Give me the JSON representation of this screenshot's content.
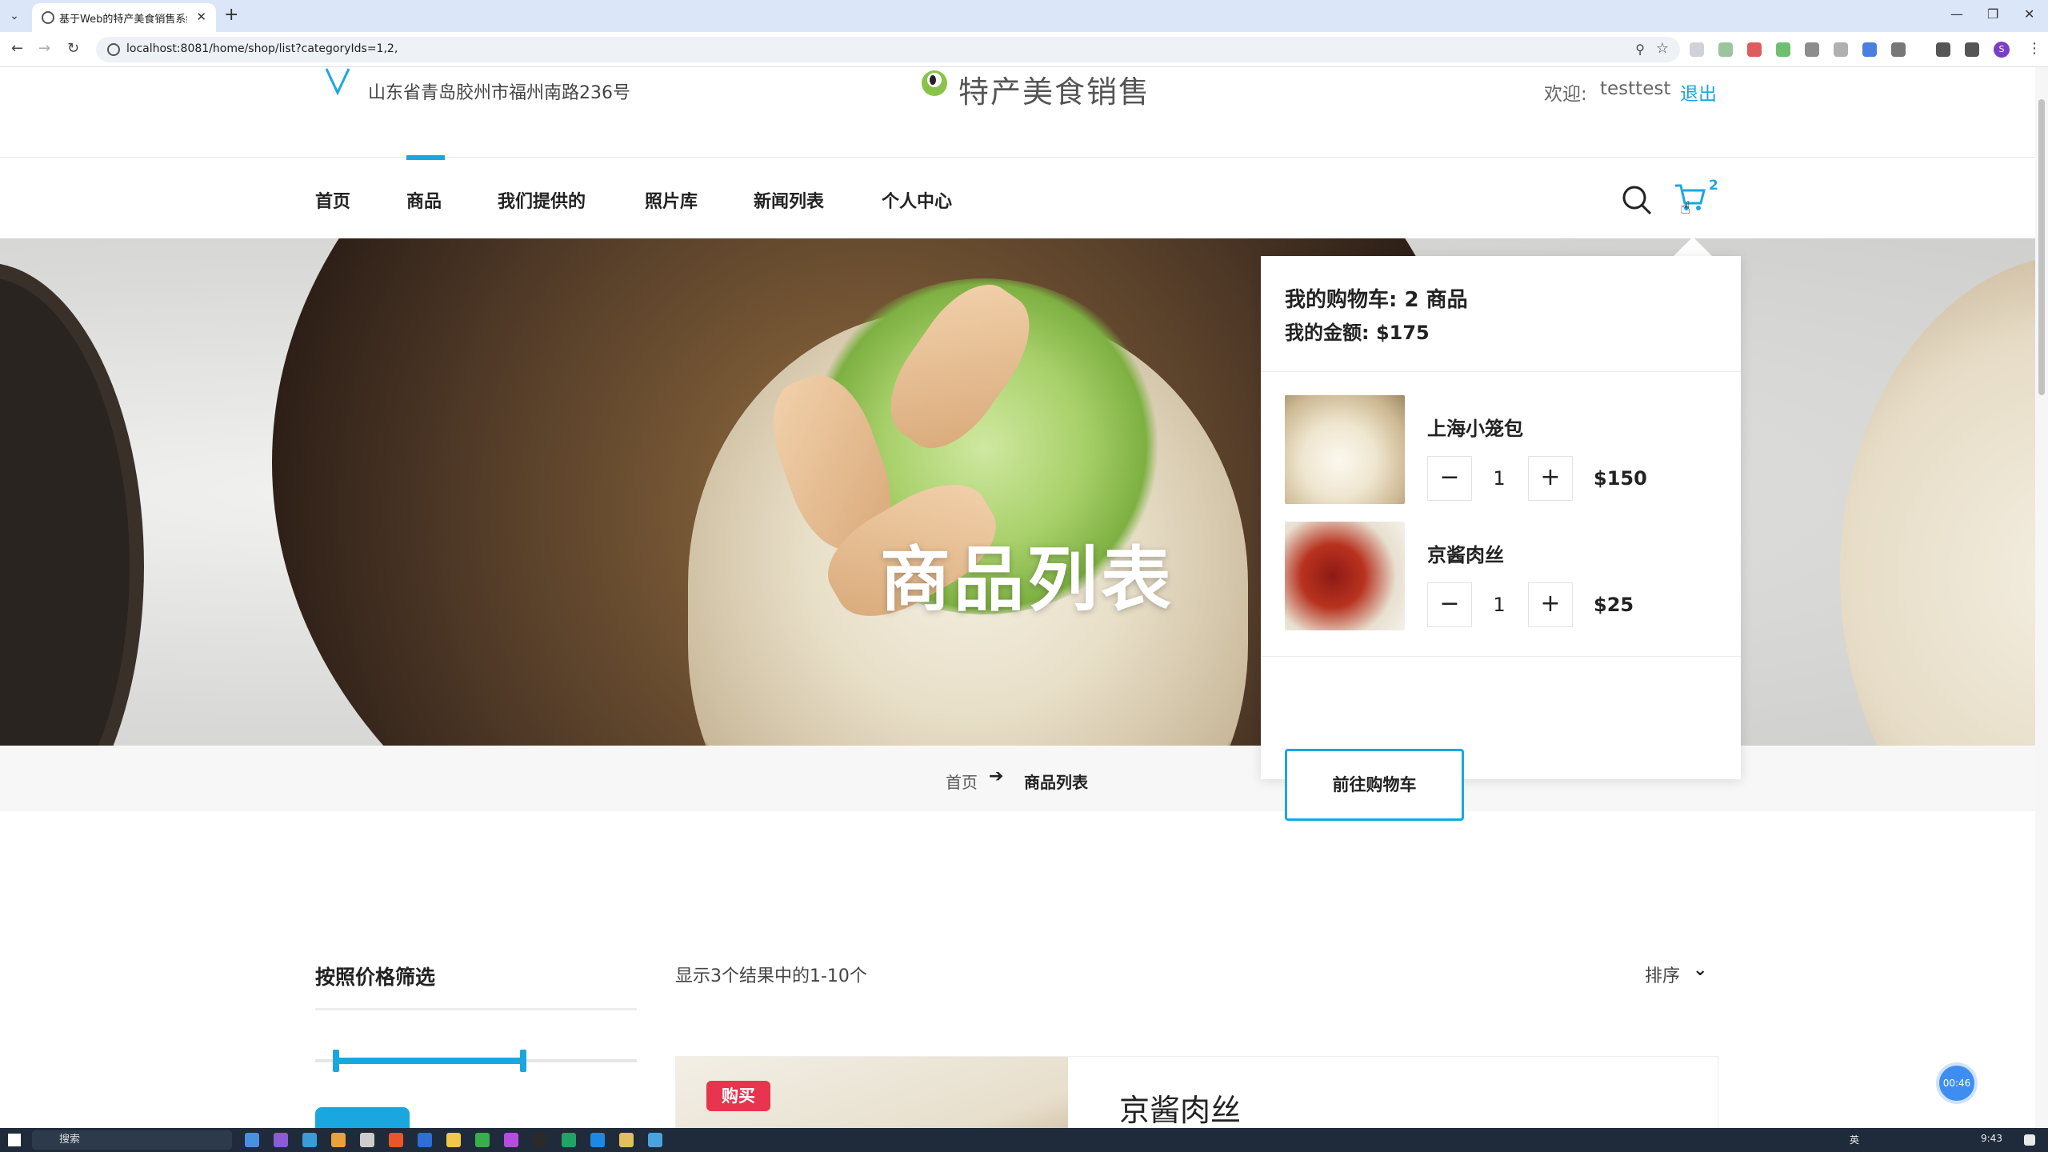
{
  "browser": {
    "tab_title": "基于Web的特产美食销售系统",
    "url": "localhost:8081/home/shop/list?categoryIds=1,2,",
    "profile_initial": "S"
  },
  "header": {
    "address": "山东省青岛胶州市福州南路236号",
    "logo_text": "特产美食销售",
    "welcome": "欢迎:",
    "username": "testtest",
    "logout": "退出"
  },
  "nav": {
    "items": [
      "首页",
      "商品",
      "我们提供的",
      "照片库",
      "新闻列表",
      "个人中心"
    ],
    "active": "商品",
    "cart_count": "2"
  },
  "hero": {
    "title": "商品列表"
  },
  "breadcrumb": {
    "home": "首页",
    "current": "商品列表"
  },
  "cart_popup": {
    "heading": "我的购物车: 2 商品",
    "total": "我的金额: $175",
    "items": [
      {
        "name": "上海小笼包",
        "qty": "1",
        "price": "$150",
        "minus": "−",
        "plus": "+"
      },
      {
        "name": "京酱肉丝",
        "qty": "1",
        "price": "$25",
        "minus": "−",
        "plus": "+"
      }
    ],
    "checkout": "前往购物车"
  },
  "sidebar": {
    "filter_title": "按照价格筛选"
  },
  "listing": {
    "result_text": "显示3个结果中的1-10个",
    "sort_label": "排序",
    "products": [
      {
        "name": "京酱肉丝",
        "badge": "购买"
      }
    ]
  },
  "widget": {
    "timer": "00:46"
  },
  "taskbar": {
    "search_placeholder": "搜索",
    "time": "9:43",
    "lang": "英"
  },
  "colors": {
    "accent": "#1aa7e0",
    "badge": "#e8344e"
  }
}
